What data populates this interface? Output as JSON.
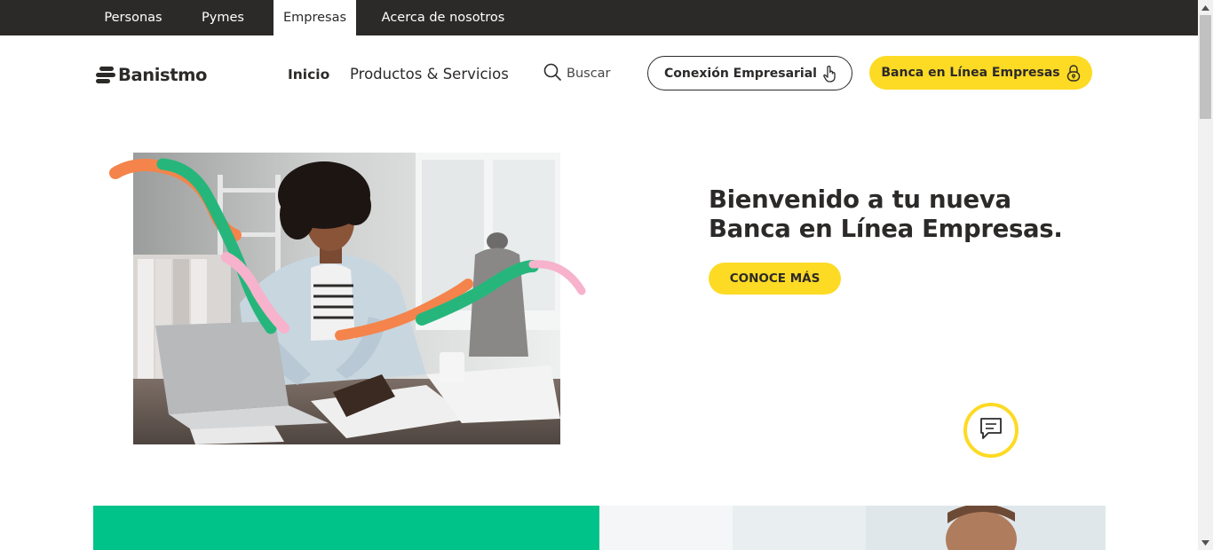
{
  "segments": [
    {
      "label": "Personas",
      "active": false
    },
    {
      "label": "Pymes",
      "active": false
    },
    {
      "label": "Empresas",
      "active": true
    },
    {
      "label": "Acerca de nosotros",
      "active": false
    }
  ],
  "header": {
    "logo_text": "Banistmo",
    "nav": [
      {
        "label": "Inicio",
        "active": true
      },
      {
        "label": "Productos & Servicios",
        "active": false
      }
    ],
    "search_label": "Buscar",
    "connect_button": "Conexión Empresarial",
    "online_button": "Banca en Línea Empresas"
  },
  "hero": {
    "title_line1": "Bienvenido a tu nueva",
    "title_line2": "Banca en Línea Empresas.",
    "cta_label": "CONOCE MÁS"
  },
  "icons": {
    "search": "search-icon",
    "connect": "hand-pointer-icon",
    "online": "lock-icon",
    "chat": "chat-icon"
  },
  "colors": {
    "brand_yellow": "#fdda24",
    "brand_dark": "#2c2a29",
    "brand_green": "#00c389",
    "ribbon_orange": "#f4844c",
    "ribbon_green": "#26b67c",
    "ribbon_pink": "#f7b2cc"
  }
}
